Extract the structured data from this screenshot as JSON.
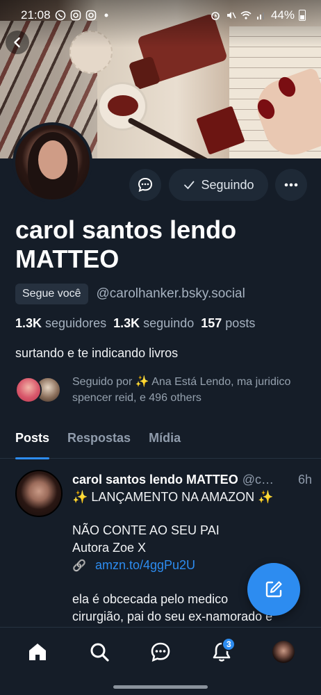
{
  "status_bar": {
    "time": "21:08",
    "battery": "44%"
  },
  "profile": {
    "display_name": "carol santos lendo MATTEO",
    "follows_you_label": "Segue você",
    "handle": "@carolhanker.bsky.social",
    "followers_count": "1.3K",
    "followers_label": "seguidores",
    "following_count": "1.3K",
    "following_label": "seguindo",
    "posts_count": "157",
    "posts_label": "posts",
    "bio": "surtando e te indicando livros",
    "followed_by_text": "Seguido por ✨ Ana Está Lendo, ma juridico spencer reid, e 496 others",
    "follow_button_label": "Seguindo"
  },
  "tabs": [
    {
      "label": "Posts",
      "active": true
    },
    {
      "label": "Respostas",
      "active": false
    },
    {
      "label": "Mídia",
      "active": false
    }
  ],
  "post": {
    "author_name": "carol santos lendo MATTEO",
    "author_handle": "@c…",
    "time": "6h",
    "line1": "✨  LANÇAMENTO NA AMAZON ✨",
    "line2": "NÃO CONTE AO SEU PAI",
    "line3": "Autora Zoe X",
    "link_icon": "🔗",
    "link_text": "amzn.to/4ggPu2U",
    "line4": "ela é obcecada pelo medico",
    "line5": "cirurgião, pai do seu ex-namorado e"
  },
  "nav": {
    "notifications_badge": "3"
  },
  "colors": {
    "background": "#151d28",
    "accent": "#2d8cf0",
    "muted": "#8f9bab"
  }
}
